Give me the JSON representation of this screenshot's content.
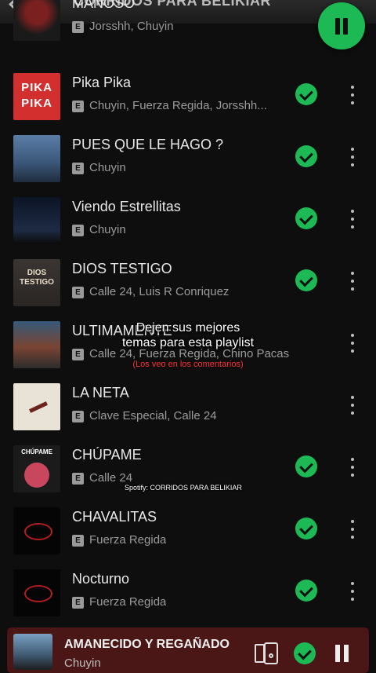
{
  "header": {
    "title": "CORRIDOS PARA BELIKIAR"
  },
  "tracks": [
    {
      "title": "MANOSO",
      "artists": "Jorsshh, Chuyin",
      "explicit_label": "E",
      "saved": false,
      "art": "dark skull character art"
    },
    {
      "title": "Pika Pika",
      "artists": "Chuyin, Fuerza Regida, Jorsshh...",
      "explicit_label": "E",
      "saved": true,
      "art_text": [
        "PIKA",
        "PIKA"
      ]
    },
    {
      "title": "PUES QUE LE HAGO ?",
      "artists": "Chuyin",
      "explicit_label": "E",
      "saved": true
    },
    {
      "title": "Viendo Estrellitas",
      "artists": "Chuyin",
      "explicit_label": "E",
      "saved": true
    },
    {
      "title": "DIOS TESTIGO",
      "artists": "Calle 24, Luis R Conriquez",
      "explicit_label": "E",
      "saved": true,
      "art_text": [
        "DIOS",
        "TESTIGO"
      ]
    },
    {
      "title": "ULTIMAMENTE",
      "artists": "Calle 24, Fuerza Regida, Chino Pacas",
      "explicit_label": "E",
      "saved": false
    },
    {
      "title": "LA NETA",
      "artists": "Clave Especial, Calle 24",
      "explicit_label": "E",
      "saved": false
    },
    {
      "title": "CHÚPAME",
      "artists": "Calle 24",
      "explicit_label": "E",
      "saved": true,
      "art_text": [
        "CHÚPAME"
      ]
    },
    {
      "title": "CHAVALITAS",
      "artists": "Fuerza Regida",
      "explicit_label": "E",
      "saved": true
    },
    {
      "title": "Nocturno",
      "artists": "Fuerza Regida",
      "explicit_label": "E",
      "saved": true
    }
  ],
  "overlay": {
    "line1": "Dejen sus mejores",
    "line2": "temas para esta playlist",
    "sub": "(Los veo en los comentarios)",
    "credit": "Spotify: CORRIDOS PARA BELIKIAR"
  },
  "now_playing": {
    "title": "AMANECIDO Y REGAÑADO",
    "artist": "Chuyin",
    "saved": true
  },
  "colors": {
    "accent": "#1db954",
    "background": "#0e0e0e",
    "now_playing_bg": "#4a1616",
    "overlay_sub": "#ff3434"
  },
  "icons": [
    "back-arrow-icon",
    "pause-icon",
    "checkmark-icon",
    "more-options-icon",
    "explicit-icon",
    "connect-device-icon"
  ]
}
